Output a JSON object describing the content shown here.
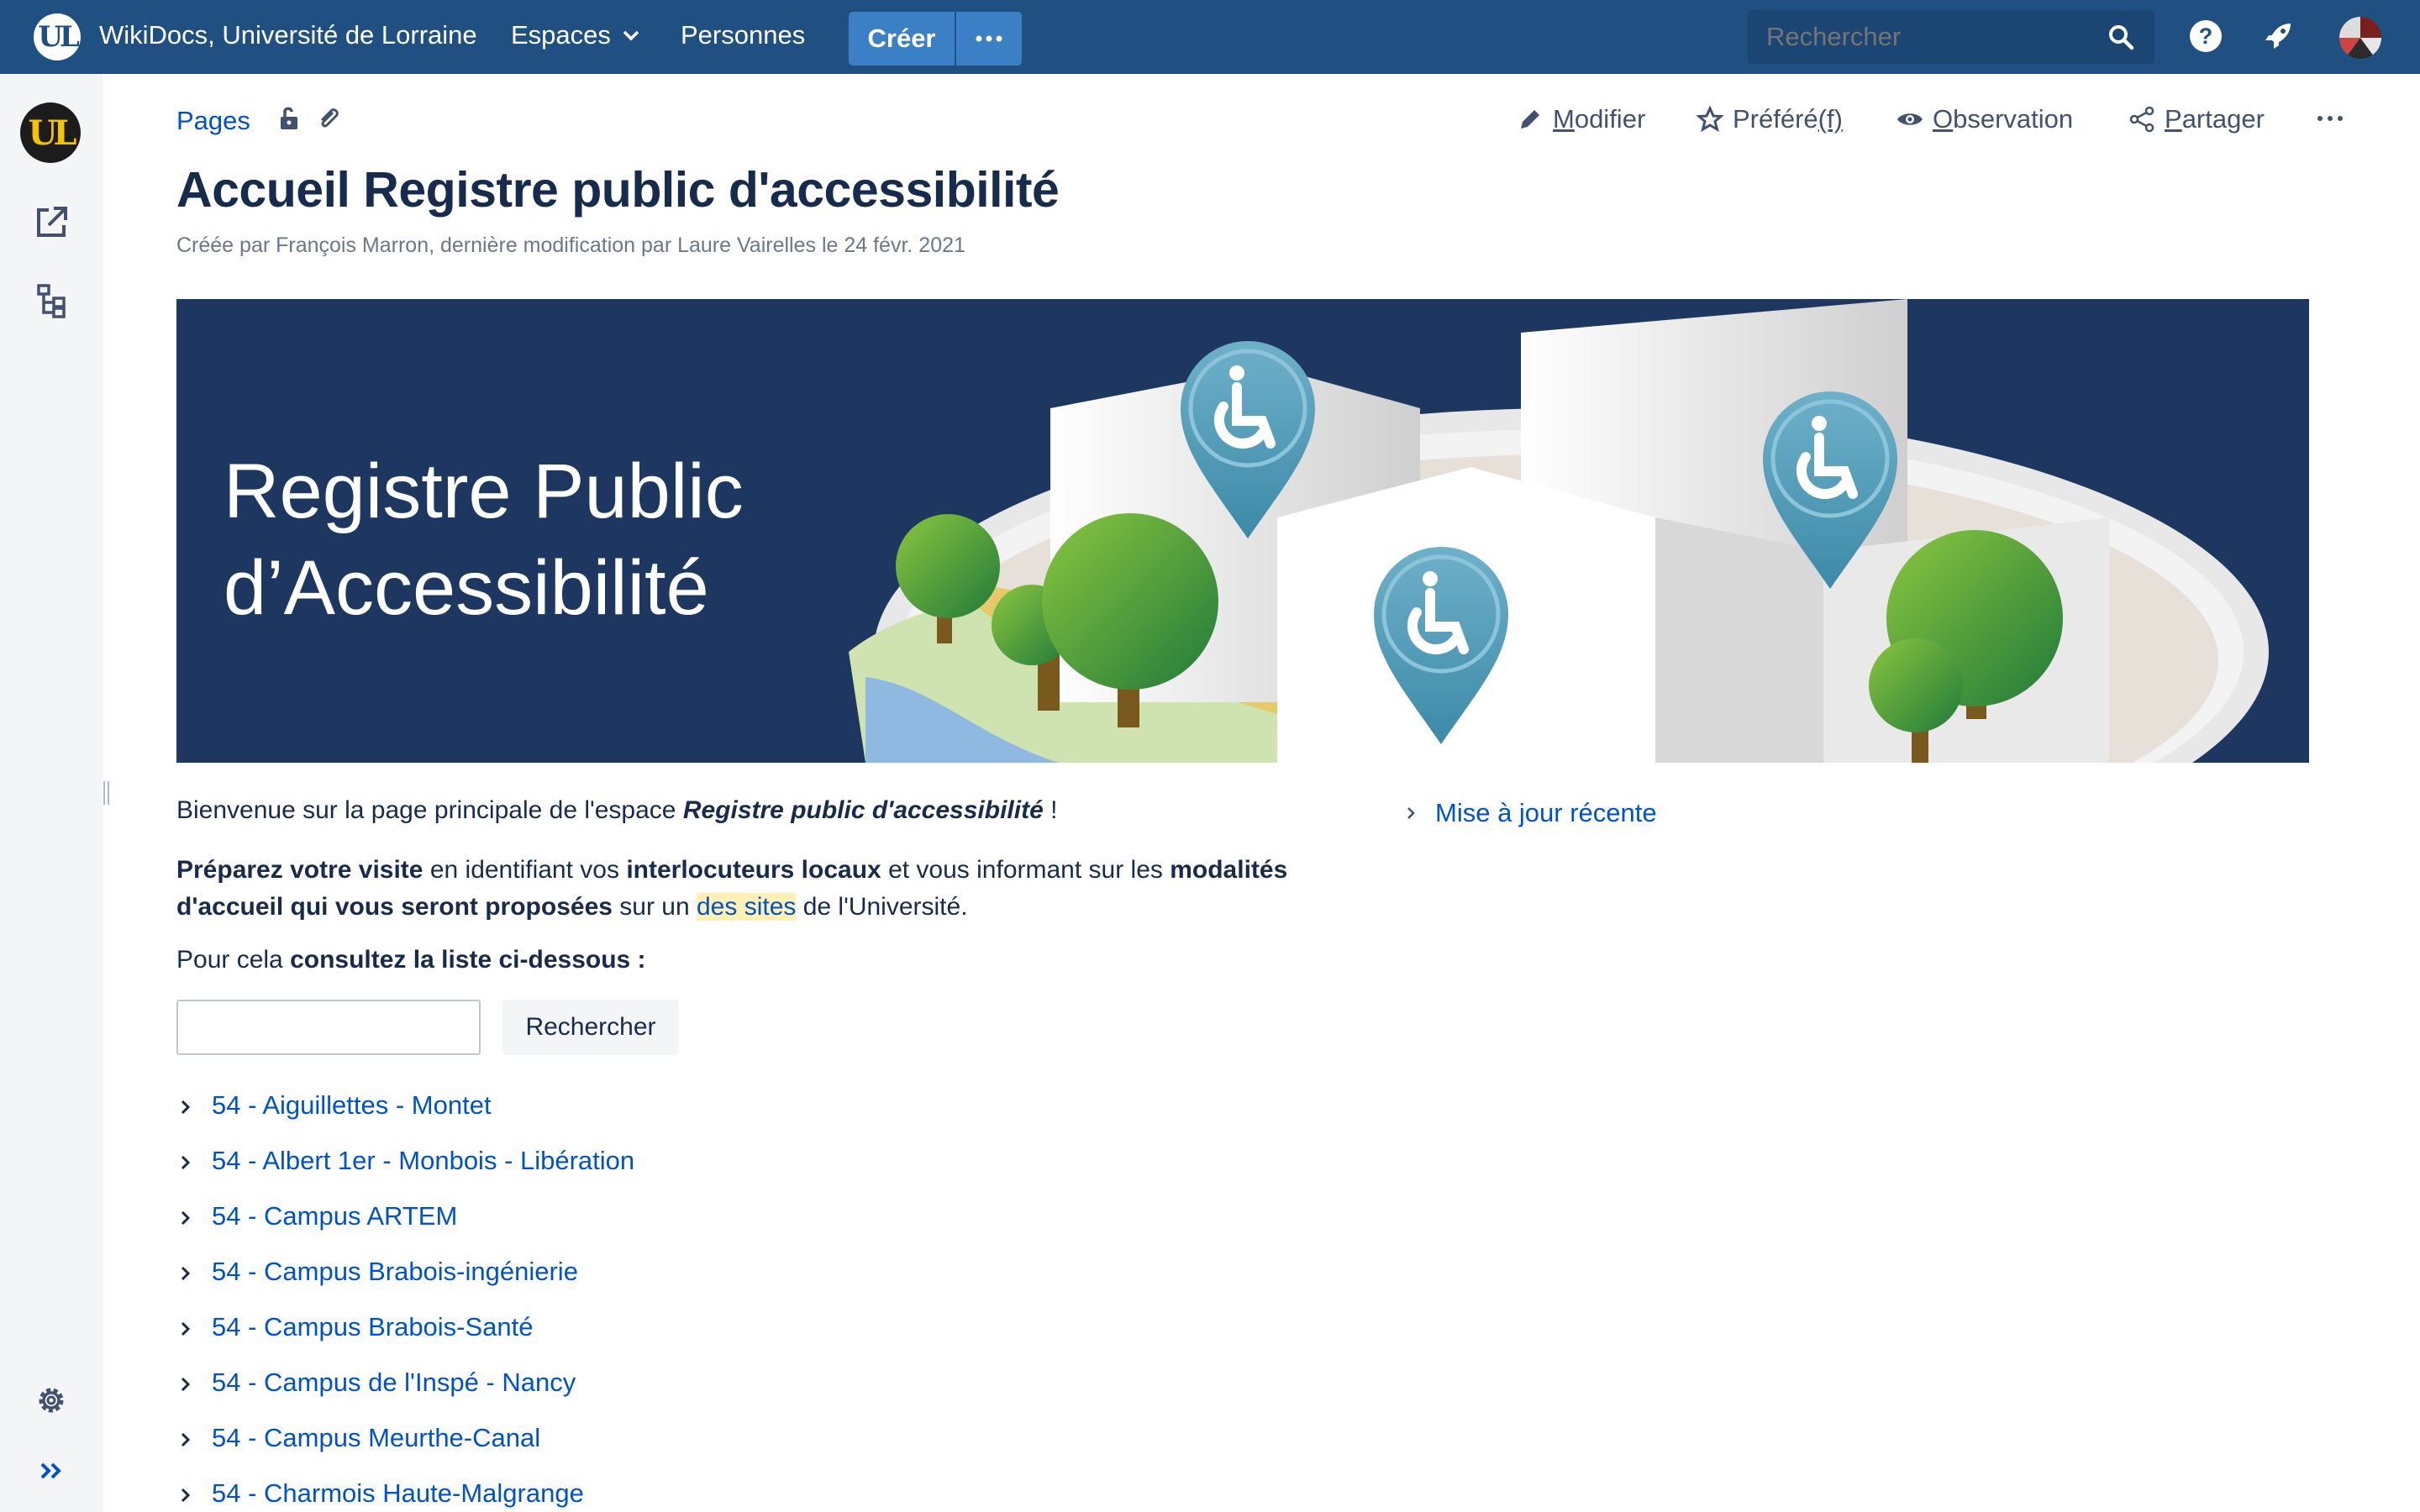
{
  "topnav": {
    "brand": "WikiDocs, Université de Lorraine",
    "espaces": "Espaces",
    "personnes": "Personnes",
    "creer": "Créer",
    "search_placeholder": "Rechercher",
    "help": "?",
    "logo_letters": "UL"
  },
  "sidebar": {
    "logo_letters": "UL"
  },
  "page_actions": {
    "pages": "Pages",
    "modifier_first": "M",
    "modifier_rest": "odifier",
    "prefere_text": "Préféré",
    "prefere_key": "(f)",
    "observation_first": "O",
    "observation_rest": "bservation",
    "partager_first": "P",
    "partager_rest": "artager"
  },
  "page": {
    "title": "Accueil Registre public d'accessibilité",
    "meta": "Créée par François Marron, dernière modification par Laure Vairelles le 24 févr. 2021"
  },
  "banner": {
    "line1": "Registre Public",
    "line2": "d’Accessibilité"
  },
  "content": {
    "p1_a": "Bienvenue sur la page principale de l'espace ",
    "p1_b": "Registre public d'accessibilité",
    "p1_c": " !",
    "p2_a": "Préparez votre visite",
    "p2_b": " en identifiant vos ",
    "p2_c": "interlocuteurs locaux",
    "p2_d": " et vous informant sur les ",
    "p2_e": "modalités d'accueil qui vous seront proposées",
    "p2_f": " sur un ",
    "p2_g": "des sites",
    "p2_h": " de l'Université.",
    "p3_a": "Pour cela ",
    "p3_b": "consultez la liste ci-dessous :",
    "search_button": "Rechercher",
    "recent_updates": "Mise à jour récente"
  },
  "sites": [
    "54 - Aiguillettes - Montet",
    "54 - Albert 1er - Monbois - Libération",
    "54 - Campus ARTEM",
    "54 - Campus Brabois-ingénierie",
    "54 - Campus Brabois-Santé",
    "54 - Campus de l'Inspé - Nancy",
    "54 - Campus Meurthe-Canal",
    "54 - Charmois Haute-Malgrange"
  ],
  "colors": {
    "nav": "#205081",
    "link": "#0052cc",
    "banner_bg": "#1d3760",
    "pin": "#4a9bb8"
  }
}
